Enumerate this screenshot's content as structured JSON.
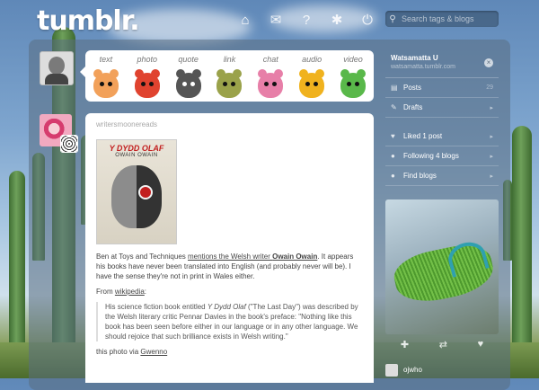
{
  "header": {
    "logo": "tumblr.",
    "nav": [
      {
        "name": "home-icon",
        "glyph": "⌂",
        "active": true
      },
      {
        "name": "mail-icon",
        "glyph": "✉",
        "active": false
      },
      {
        "name": "help-icon",
        "glyph": "?",
        "active": false
      },
      {
        "name": "settings-gear-icon",
        "glyph": "✱",
        "active": false
      },
      {
        "name": "power-icon",
        "glyph": "⏻",
        "active": false
      }
    ],
    "search_placeholder": "Search tags & blogs"
  },
  "post_bar": {
    "items": [
      {
        "label": "text",
        "color": "#f2a15a"
      },
      {
        "label": "photo",
        "color": "#e0432f"
      },
      {
        "label": "quote",
        "color": "#555555"
      },
      {
        "label": "link",
        "color": "#9aa24a"
      },
      {
        "label": "chat",
        "color": "#e77fa8"
      },
      {
        "label": "audio",
        "color": "#f0b21e"
      },
      {
        "label": "video",
        "color": "#59b84a"
      }
    ]
  },
  "post": {
    "username": "writersmoonereads",
    "photo": {
      "title": "Y DYDD OLAF",
      "author": "OWAIN OWAIN"
    },
    "p1_pre": "Ben at Toys and Techniques ",
    "p1_link1": "mentions the Welsh writer ",
    "p1_link2": "Owain Owain",
    "p1_post": ". It appears his books have never been translated into English (and probably never will be). I have the sense they're not in print in Wales either.",
    "p2_pre": "From ",
    "p2_link": "wikipedia",
    "p2_post": ":",
    "quote_pre": "His science fiction book entitled ",
    "quote_title": "Y Dydd Olaf",
    "quote_post": " (\"The Last Day\") was described by the Welsh literary critic Pennar Davies in the book's preface: \"Nothing like this book has been seen before either in our language or in any other language. We should rejoice that such brilliance exists in Welsh writing.\"",
    "via_pre": "this photo via ",
    "via_link": "Gwenno"
  },
  "sidebar": {
    "account_name": "Watsamatta U",
    "account_email": "watsamatta.tumblr.com",
    "close_glyph": "×",
    "posts_label": "Posts",
    "posts_count": "29",
    "drafts_label": "Drafts",
    "liked_label": "Liked 1 post",
    "following_label": "Following 4 blogs",
    "find_label": "Find blogs",
    "follower_name": "ojwho"
  },
  "radar_actions": [
    "✚",
    "⇄",
    "♥"
  ]
}
